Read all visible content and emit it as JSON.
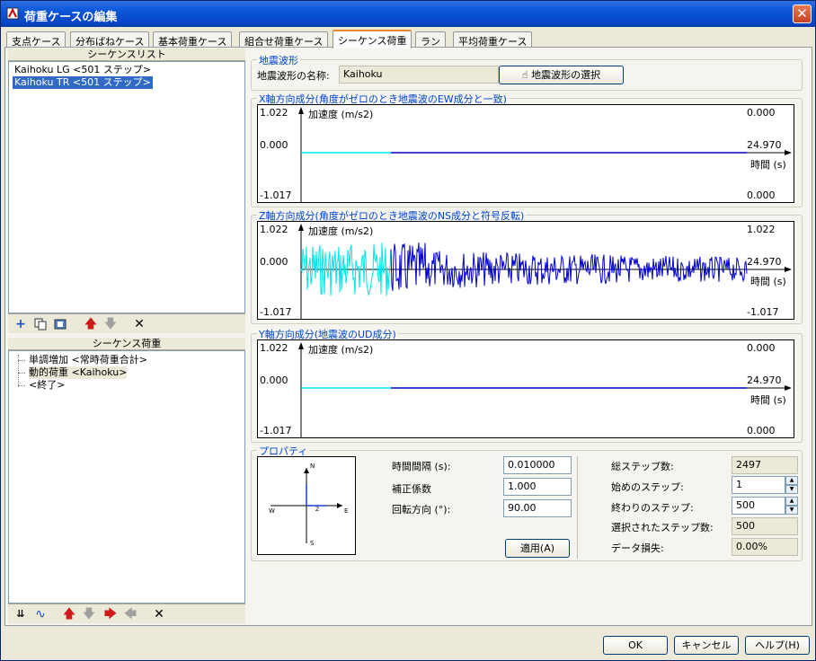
{
  "window": {
    "title": "荷重ケースの編集"
  },
  "tabs": [
    "支点ケース",
    "分布ばねケース",
    "基本荷重ケース",
    "組合せ荷重ケース",
    "シーケンス荷重",
    "ラン",
    "平均荷重ケース"
  ],
  "sequence_list": {
    "header": "シーケンスリスト",
    "items": [
      "Kaihoku LG <501 ステップ>",
      "Kaihoku TR <501 ステップ>"
    ]
  },
  "sequence_load": {
    "header": "シーケンス荷重",
    "items": [
      "単調増加 <常時荷重合計>",
      "動的荷重 <Kaihoku>",
      "<終了>"
    ]
  },
  "waveform": {
    "group_label": "地震波形",
    "name_label": "地震波形の名称:",
    "name_value": "Kaihoku",
    "select_button": "地震波形の選択"
  },
  "plots": [
    {
      "title": "X軸方向成分(角度がゼロのとき地震波のEW成分と一致)",
      "ymax": "1.022",
      "yzero": "0.000",
      "ymin": "-1.017",
      "ylabel": "加速度 (m/s2)",
      "xlabel": "時間 (s)",
      "r_top": "0.000",
      "r_mid": "24.970",
      "r_bot": "0.000"
    },
    {
      "title": "Z軸方向成分(角度がゼロのとき地震波のNS成分と符号反転)",
      "ymax": "1.022",
      "yzero": "0.000",
      "ymin": "-1.017",
      "ylabel": "加速度 (m/s2)",
      "xlabel": "時間 (s)",
      "r_top": "1.022",
      "r_mid": "24.970",
      "r_bot": "-1.017"
    },
    {
      "title": "Y軸方向成分(地震波のUD成分)",
      "ymax": "1.022",
      "yzero": "0.000",
      "ymin": "-1.017",
      "ylabel": "加速度 (m/s2)",
      "xlabel": "時間 (s)",
      "r_top": "0.000",
      "r_mid": "24.970",
      "r_bot": "0.000"
    }
  ],
  "properties": {
    "group_label": "プロパティ",
    "compass": {
      "n": "N",
      "s": "S",
      "e": "E",
      "w": "W",
      "z": "Z"
    },
    "time_interval_label": "時間間隔 (s):",
    "time_interval": "0.010000",
    "correction_label": "補正係数",
    "correction": "1.000",
    "rotation_label": "回転方向 (°):",
    "rotation": "90.00",
    "apply_button": "適用(A)",
    "total_steps_label": "総ステップ数:",
    "total_steps": "2497",
    "start_step_label": "始めのステップ:",
    "start_step": "1",
    "end_step_label": "終わりのステップ:",
    "end_step": "500",
    "selected_steps_label": "選択されたステップ数:",
    "selected_steps": "500",
    "data_loss_label": "データ損失:",
    "data_loss": "0.00%"
  },
  "footer": {
    "ok": "OK",
    "cancel": "キャンセル",
    "help": "ヘルプ(H)"
  },
  "colors": {
    "selected_wave": "#00e5e5",
    "wave": "#0000c8",
    "accent": "#316ac5"
  },
  "icons": {
    "add": "plus-icon",
    "copy": "copy-icon",
    "paste": "paste-icon",
    "up": "arrow-up-icon",
    "down": "arrow-down-icon",
    "delete": "x-icon"
  }
}
